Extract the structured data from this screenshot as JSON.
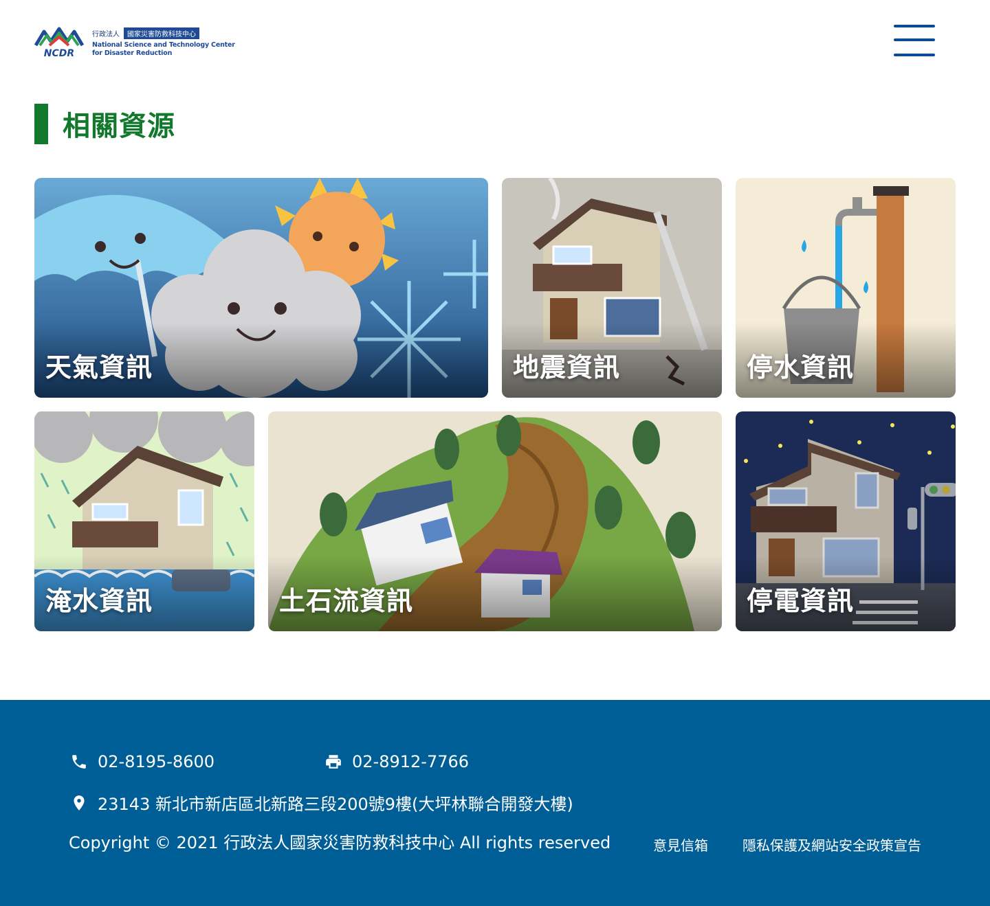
{
  "header": {
    "logo": {
      "mark_text": "NCDR",
      "org_prefix": "行政法人",
      "name_zh": "國家災害防救科技中心",
      "name_en_line1": "National Science and Technology Center",
      "name_en_line2": "for Disaster Reduction"
    },
    "menu_icon": "hamburger-icon"
  },
  "section": {
    "title": "相關資源"
  },
  "cards": {
    "weather": "天氣資訊",
    "earthquake": "地震資訊",
    "water_outage": "停水資訊",
    "flood": "淹水資訊",
    "debris_flow": "土石流資訊",
    "power_outage": "停電資訊"
  },
  "footer": {
    "phone": "02-8195-8600",
    "fax": "02-8912-7766",
    "address": "23143 新北市新店區北新路三段200號9樓(大坪林聯合開發大樓)",
    "copyright": "Copyright © 2021 行政法人國家災害防救科技中心 All rights reserved",
    "links": {
      "mailbox": "意見信箱",
      "privacy": "隱私保護及網站安全政策宣告"
    }
  },
  "colors": {
    "brand_green": "#12782c",
    "brand_blue": "#0d4a95",
    "footer_bg": "#005e97"
  }
}
